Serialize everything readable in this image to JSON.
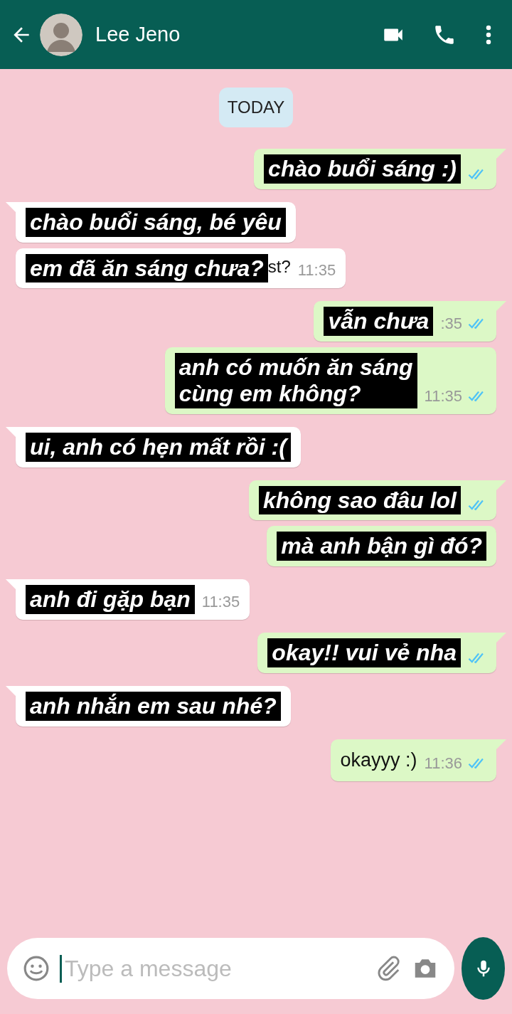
{
  "header": {
    "contact_name": "Lee Jeno"
  },
  "date_chip": "TODAY",
  "messages": [
    {
      "kind": "outgoing",
      "tail": true,
      "captioned": true,
      "lines": [
        "chào buổi sáng :)"
      ],
      "read": true
    },
    {
      "kind": "incoming",
      "tail": true,
      "captioned": true,
      "lines": [
        "chào buổi sáng, bé yêu"
      ]
    },
    {
      "kind": "incoming",
      "tail": false,
      "captioned": true,
      "lines": [
        "em đã ăn sáng chưa?"
      ],
      "leftover": "st?",
      "time": "11:35"
    },
    {
      "kind": "outgoing",
      "tail": true,
      "captioned": true,
      "lines": [
        "vẫn chưa"
      ],
      "time": ":35",
      "read": true
    },
    {
      "kind": "outgoing",
      "tail": false,
      "captioned": true,
      "lines": [
        "anh có muốn ăn sáng",
        "cùng em không?"
      ],
      "time": "11:35",
      "read": true
    },
    {
      "kind": "incoming",
      "tail": true,
      "captioned": true,
      "lines": [
        "ui, anh có hẹn mất rồi :("
      ]
    },
    {
      "kind": "outgoing",
      "tail": true,
      "captioned": true,
      "lines": [
        "không sao đâu lol"
      ],
      "read": true
    },
    {
      "kind": "outgoing",
      "tail": false,
      "captioned": true,
      "lines": [
        "mà anh bận gì đó?"
      ]
    },
    {
      "kind": "incoming",
      "tail": true,
      "captioned": true,
      "lines": [
        "anh đi gặp bạn"
      ],
      "time": "11:35"
    },
    {
      "kind": "outgoing",
      "tail": true,
      "captioned": true,
      "lines": [
        "okay!! vui vẻ nha"
      ],
      "read": true
    },
    {
      "kind": "incoming",
      "tail": true,
      "captioned": true,
      "lines": [
        "anh nhắn em sau nhé?"
      ]
    },
    {
      "kind": "outgoing",
      "tail": true,
      "captioned": false,
      "lines": [
        "okayyy :)"
      ],
      "time": "11:36",
      "read": true
    }
  ],
  "composer": {
    "placeholder": "Type a message"
  }
}
